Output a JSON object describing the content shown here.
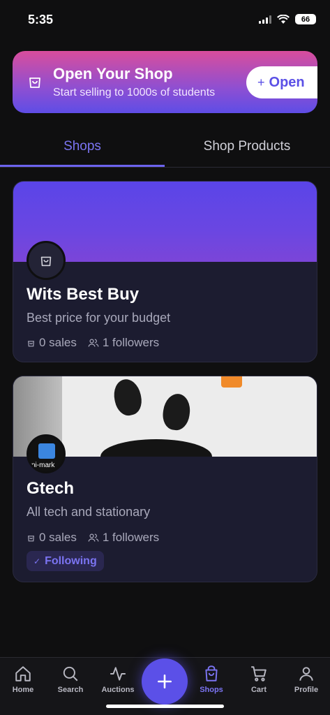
{
  "status_bar": {
    "time": "5:35",
    "battery": "66"
  },
  "banner": {
    "title": "Open Your Shop",
    "subtitle": "Start selling to 1000s of students",
    "button_label": "Open",
    "button_icon": "plus-icon",
    "icon": "shop-bag-icon"
  },
  "tabs": [
    {
      "label": "Shops",
      "active": true
    },
    {
      "label": "Shop Products",
      "active": false
    }
  ],
  "shops": [
    {
      "name": "Wits Best Buy",
      "description": "Best price for your budget",
      "sales": "0 sales",
      "followers": "1 followers"
    },
    {
      "name": "Gtech",
      "description": "All tech and stationary",
      "sales": "0 sales",
      "followers": "1 followers",
      "avatar_text": "ni-mark",
      "badge": "Following"
    }
  ],
  "nav": {
    "home": "Home",
    "search": "Search",
    "auctions": "Auctions",
    "shops": "Shops",
    "cart": "Cart",
    "profile": "Profile"
  },
  "colors": {
    "accent": "#5b50e8",
    "active_tab": "#7b74f2",
    "background": "#0f0f10",
    "card": "#1c1c30"
  }
}
